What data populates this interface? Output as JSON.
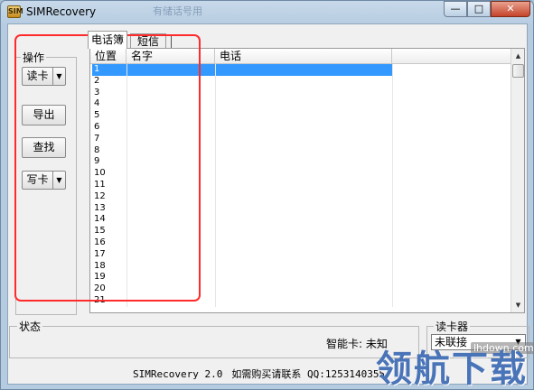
{
  "window": {
    "title": "SIMRecovery",
    "faint_tab_text": "有储话号用",
    "buttons": {
      "minimize": "—",
      "maximize": "□",
      "close": "✕"
    },
    "app_icon": "app-icon"
  },
  "operations": {
    "label": "操作",
    "read_card": "读卡",
    "export": "导出",
    "find": "查找",
    "write_card": "写卡",
    "dropdown_arrow": "▼"
  },
  "tabs": [
    {
      "label": "电话簿",
      "active": true
    },
    {
      "label": "短信",
      "active": false
    }
  ],
  "phonebook": {
    "columns": [
      "位置",
      "名字",
      "电话"
    ],
    "rows": [
      "1",
      "2",
      "3",
      "4",
      "5",
      "6",
      "7",
      "8",
      "9",
      "10",
      "11",
      "12",
      "13",
      "14",
      "15",
      "16",
      "17",
      "18",
      "19",
      "20",
      "21"
    ],
    "selected_row": "1",
    "scroll_up": "▲",
    "scroll_down": "▼"
  },
  "status": {
    "label": "状态",
    "smartcard_text": "智能卡: 未知"
  },
  "reader": {
    "label": "读卡器",
    "value": "未联接",
    "dropdown_arrow": "▼"
  },
  "footer": {
    "version": "SIMRecovery 2.0",
    "contact": "如需购买请联系 QQ:1253140355"
  },
  "watermark": {
    "site": "lhdown.com",
    "brand": "领航下载"
  },
  "colors": {
    "selection": "#3399ff",
    "annotation_box": "#ff2b2b",
    "watermark": "#4a74b8"
  }
}
